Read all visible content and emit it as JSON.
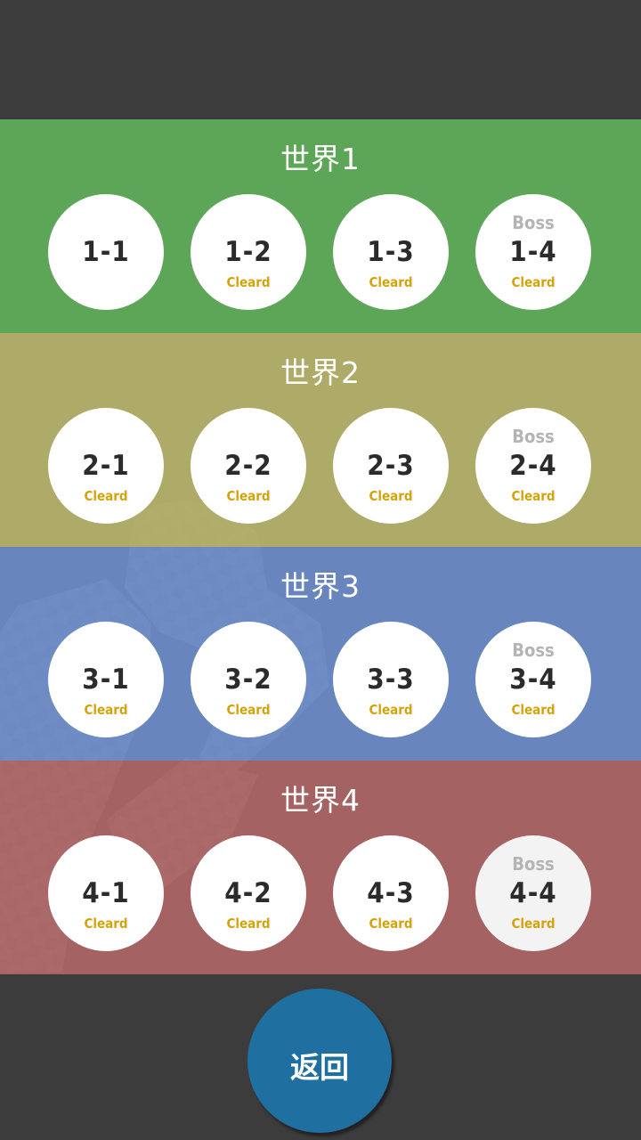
{
  "colors": {
    "background": "#3c3c3c",
    "circle": "#ffffff",
    "circle_selected": "#f3f3f3",
    "number_text": "#2b2b2b",
    "boss_text": "#b4b4b4",
    "clear_text": "#d4a20c",
    "back_button": "#1f6fa0"
  },
  "worlds": [
    {
      "title": "世界1",
      "color": "rgba(94,168,88,0.97)",
      "stages": [
        {
          "label": "1-1",
          "boss": "",
          "status": ""
        },
        {
          "label": "1-2",
          "boss": "",
          "status": "Cleard"
        },
        {
          "label": "1-3",
          "boss": "",
          "status": "Cleard"
        },
        {
          "label": "1-4",
          "boss": "Boss",
          "status": "Cleard"
        }
      ]
    },
    {
      "title": "世界2",
      "color": "rgba(180,176,105,0.95)",
      "stages": [
        {
          "label": "2-1",
          "boss": "",
          "status": "Cleard"
        },
        {
          "label": "2-2",
          "boss": "",
          "status": "Cleard"
        },
        {
          "label": "2-3",
          "boss": "",
          "status": "Cleard"
        },
        {
          "label": "2-4",
          "boss": "Boss",
          "status": "Cleard"
        }
      ]
    },
    {
      "title": "世界3",
      "color": "rgba(112,144,208,0.88)",
      "stages": [
        {
          "label": "3-1",
          "boss": "",
          "status": "Cleard"
        },
        {
          "label": "3-2",
          "boss": "",
          "status": "Cleard"
        },
        {
          "label": "3-3",
          "boss": "",
          "status": "Cleard"
        },
        {
          "label": "3-4",
          "boss": "Boss",
          "status": "Cleard"
        }
      ]
    },
    {
      "title": "世界4",
      "color": "rgba(180,104,104,0.88)",
      "stages": [
        {
          "label": "4-1",
          "boss": "",
          "status": "Cleard"
        },
        {
          "label": "4-2",
          "boss": "",
          "status": "Cleard"
        },
        {
          "label": "4-3",
          "boss": "",
          "status": "Cleard"
        },
        {
          "label": "4-4",
          "boss": "Boss",
          "status": "Cleard",
          "selected": true
        }
      ]
    }
  ],
  "back_button": {
    "label": "返回"
  }
}
